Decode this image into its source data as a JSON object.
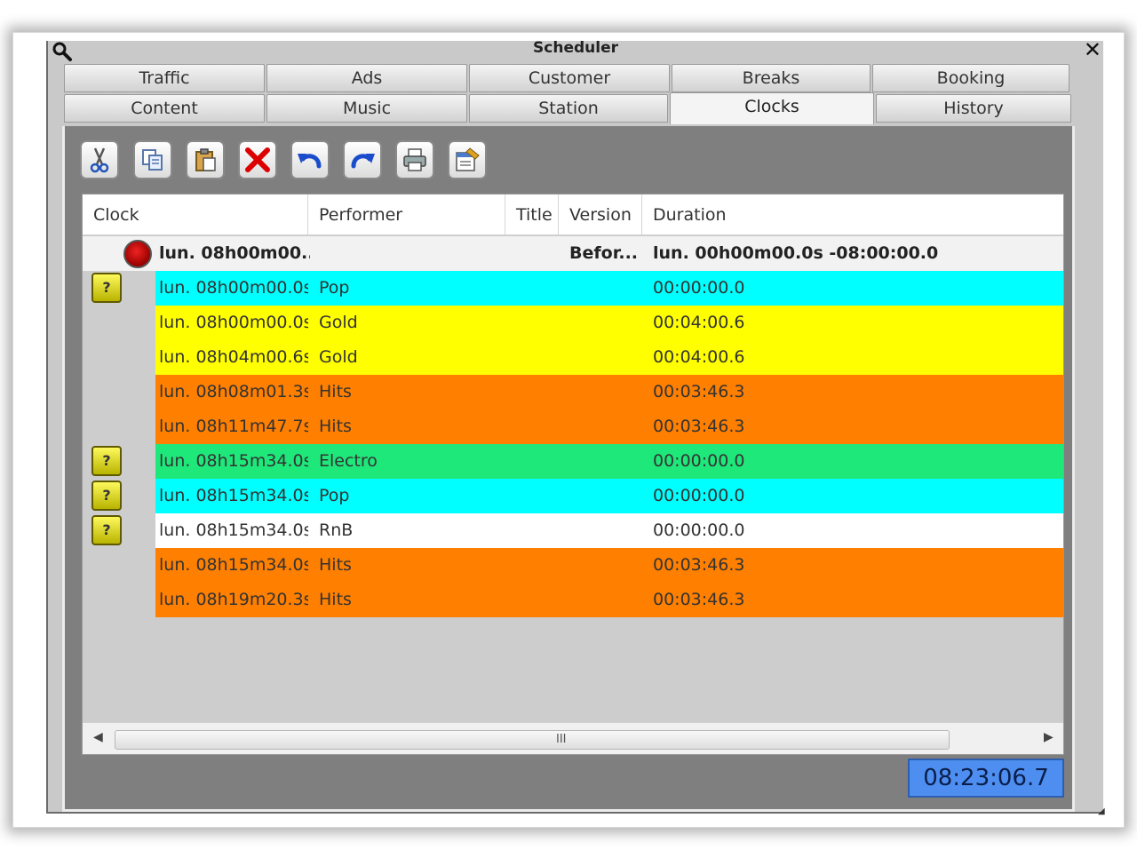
{
  "window": {
    "title": "Scheduler"
  },
  "tabs": {
    "row1": [
      "Traffic",
      "Ads",
      "Customer",
      "Breaks",
      "Booking"
    ],
    "row2": [
      "Content",
      "Music",
      "Station",
      "Clocks",
      "History"
    ],
    "active": "Clocks"
  },
  "toolbar": [
    {
      "name": "cut",
      "icon": "scissors-icon"
    },
    {
      "name": "copy",
      "icon": "copy-icon"
    },
    {
      "name": "paste",
      "icon": "paste-icon"
    },
    {
      "name": "delete",
      "icon": "red-x-icon"
    },
    {
      "name": "undo",
      "icon": "undo-arrow-icon"
    },
    {
      "name": "redo",
      "icon": "redo-arrow-icon"
    },
    {
      "name": "print",
      "icon": "printer-icon"
    },
    {
      "name": "properties",
      "icon": "properties-icon"
    }
  ],
  "grid": {
    "columns": [
      "Clock",
      "Performer",
      "Title",
      "Version",
      "Duration"
    ],
    "header_row": {
      "clock": "lun. 08h00m00....",
      "version": "Befor...",
      "duration": "lun. 00h00m00.0s -08:00:00.0"
    },
    "rows": [
      {
        "badge": "?",
        "clock": "lun. 08h00m00.0s",
        "performer": "Pop",
        "duration": "00:00:00.0",
        "color": "#00ffff"
      },
      {
        "badge": "",
        "clock": "lun. 08h00m00.0s",
        "performer": "Gold",
        "duration": "00:04:00.6",
        "color": "#ffff00"
      },
      {
        "badge": "",
        "clock": "lun. 08h04m00.6s",
        "performer": "Gold",
        "duration": "00:04:00.6",
        "color": "#ffff00"
      },
      {
        "badge": "",
        "clock": "lun. 08h08m01.3s",
        "performer": "Hits",
        "duration": "00:03:46.3",
        "color": "#ff7f00"
      },
      {
        "badge": "",
        "clock": "lun. 08h11m47.7s",
        "performer": "Hits",
        "duration": "00:03:46.3",
        "color": "#ff7f00"
      },
      {
        "badge": "?",
        "clock": "lun. 08h15m34.0s",
        "performer": "Electro",
        "duration": "00:00:00.0",
        "color": "#1ee87a"
      },
      {
        "badge": "?",
        "clock": "lun. 08h15m34.0s",
        "performer": "Pop",
        "duration": "00:00:00.0",
        "color": "#00ffff"
      },
      {
        "badge": "?",
        "clock": "lun. 08h15m34.0s",
        "performer": "RnB",
        "duration": "00:00:00.0",
        "color": "#ffffff"
      },
      {
        "badge": "",
        "clock": "lun. 08h15m34.0s",
        "performer": "Hits",
        "duration": "00:03:46.3",
        "color": "#ff7f00"
      },
      {
        "badge": "",
        "clock": "lun. 08h19m20.3s",
        "performer": "Hits",
        "duration": "00:03:46.3",
        "color": "#ff7f00"
      }
    ]
  },
  "scrollbar": {
    "grip": "III"
  },
  "status": {
    "time": "08:23:06.7"
  }
}
